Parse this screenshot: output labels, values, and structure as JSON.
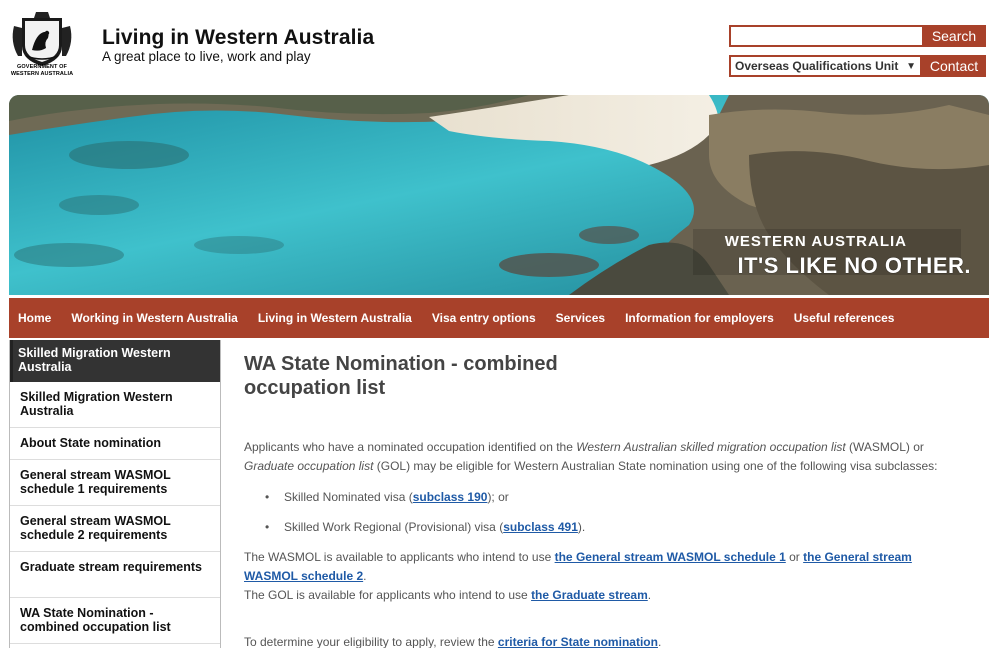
{
  "header": {
    "crest_caption": "GOVERNMENT OF WESTERN AUSTRALIA",
    "title": "Living in Western Australia",
    "tagline": "A great place to live, work and play",
    "search_placeholder": "",
    "search_label": "Search",
    "unit_selected": "Overseas Qualifications Unit",
    "contact_label": "Contact"
  },
  "hero": {
    "line1": "WESTERN AUSTRALIA",
    "line2": "IT'S LIKE NO OTHER."
  },
  "nav": {
    "items": [
      "Home",
      "Working in Western Australia",
      "Living in Western Australia",
      "Visa entry options",
      "Services",
      "Information for employers",
      "Useful references"
    ]
  },
  "sidebar": {
    "heading": "Skilled Migration Western Australia",
    "items": [
      "Skilled Migration Western Australia",
      "About State nomination",
      "General stream WASMOL schedule 1 requirements",
      "General stream WASMOL schedule 2 requirements",
      "Graduate stream requirements",
      "WA State Nomination - combined occupation list"
    ]
  },
  "main": {
    "title": "WA State Nomination - combined occupation list",
    "intro_1": "Applicants who have a nominated occupation identified on the ",
    "intro_em1": "Western Australian skilled migration occupation list",
    "intro_2": " (WASMOL) or ",
    "intro_em2": "Graduate occupation list",
    "intro_3": " (GOL) may be eligible for Western Australian State nomination using one of the following visa subclasses:",
    "bullet1_pre": "Skilled Nominated visa (",
    "bullet1_link": "subclass 190",
    "bullet1_post": "); or",
    "bullet2_pre": "Skilled Work Regional (Provisional) visa (",
    "bullet2_link": "subclass 491",
    "bullet2_post": ").",
    "wasmol_pre": "The WASMOL is available to applicants who intend to use ",
    "wasmol_link1": "the General stream WASMOL schedule 1",
    "wasmol_mid": " or ",
    "wasmol_link2": "the General stream WASMOL schedule 2",
    "wasmol_post": ".",
    "gol_pre": "The GOL is available for applicants who intend to use ",
    "gol_link": "the Graduate stream",
    "gol_post": ".",
    "elig_pre": "To determine your eligibility to apply, review the ",
    "elig_link": "criteria for State nomination",
    "elig_post": "."
  },
  "colors": {
    "brand": "#a8412a",
    "link": "#1f5aa6",
    "sidebar_head": "#333333"
  }
}
